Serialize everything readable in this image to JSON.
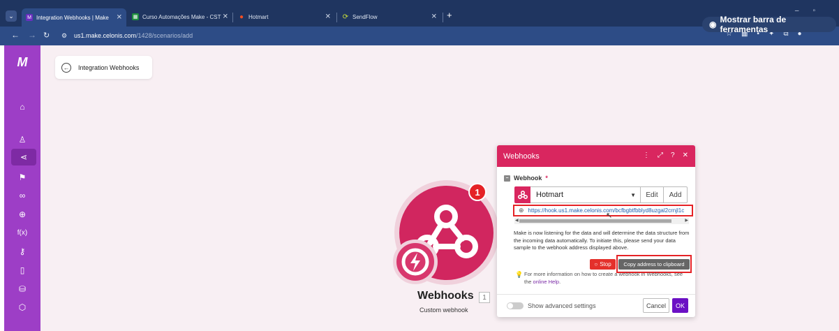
{
  "browser": {
    "tabs": [
      {
        "title": "Integration Webhooks | Make",
        "active": true
      },
      {
        "title": "Curso Automações Make - CST",
        "active": false
      },
      {
        "title": "Hotmart",
        "active": false
      },
      {
        "title": "SendFlow",
        "active": false
      }
    ],
    "url_host": "us1.make.celonis.com",
    "url_path": "/1428/scenarios/add",
    "toolbar_hint": "Mostrar barra de ferramentas",
    "new_tab": "+"
  },
  "sidebar": {
    "logo": "M",
    "items": [
      "home-icon",
      "team-icon",
      "scenarios-icon",
      "templates-icon",
      "connections-icon",
      "webhooks-icon",
      "functions-icon",
      "keys-icon",
      "devices-icon",
      "datastores-icon",
      "datastructures-icon"
    ]
  },
  "scenario": {
    "back_label": "Integration Webhooks",
    "node_title": "Webhooks",
    "node_number": "1",
    "node_subtitle": "Custom webhook",
    "badge": "1"
  },
  "dialog": {
    "title": "Webhooks",
    "field_label": "Webhook",
    "required_mark": "*",
    "selected_webhook": "Hotmart",
    "edit_label": "Edit",
    "add_label": "Add",
    "webhook_url": "https://hook.us1.make.celonis.com/bcfbgbtfbblyd8uzgal2crnjl1c",
    "info_text": "Make is now listening for the data and will determine the data structure from the incoming data automatically. To initiate this, please send your data sample to the webhook address displayed above.",
    "stop_label": "Stop",
    "copy_label": "Copy address to clipboard",
    "tip_text": "For more information on how to create a webhook in Webhooks, see the",
    "tip_link": "online Help",
    "tip_end": ".",
    "advanced_label": "Show advanced settings",
    "cancel_label": "Cancel",
    "ok_label": "OK"
  },
  "colors": {
    "brand": "#d9265f",
    "sidebar": "#9d3ec6",
    "ok": "#6b10c4",
    "highlight": "#e52226"
  }
}
